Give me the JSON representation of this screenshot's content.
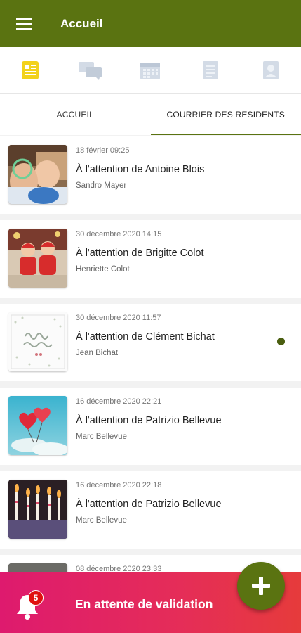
{
  "appbar": {
    "title": "Accueil",
    "menu_icon": "menu-icon",
    "color": "#5a7311"
  },
  "iconbar": {
    "items": [
      {
        "icon": "newspaper-icon",
        "active": true
      },
      {
        "icon": "chat-bubbles-icon",
        "active": false
      },
      {
        "icon": "calendar-icon",
        "active": false
      },
      {
        "icon": "document-icon",
        "active": false
      },
      {
        "icon": "contact-card-icon",
        "active": false
      }
    ]
  },
  "tabs": [
    {
      "label": "ACCUEIL",
      "active": false
    },
    {
      "label": "COURRIER DES RESIDENTS",
      "active": true
    }
  ],
  "messages": [
    {
      "date": "18 février 09:25",
      "title": "À l'attention de Antoine Blois",
      "author": "Sandro Mayer",
      "unread": false
    },
    {
      "date": "30 décembre 2020 14:15",
      "title": "À l'attention de Brigitte Colot",
      "author": "Henriette Colot",
      "unread": false
    },
    {
      "date": "30 décembre 2020 11:57",
      "title": "À l'attention de Clément Bichat",
      "author": "Jean Bichat",
      "unread": true
    },
    {
      "date": "16 décembre 2020 22:21",
      "title": "À l'attention de Patrizio Bellevue",
      "author": "Marc Bellevue",
      "unread": false
    },
    {
      "date": "16 décembre 2020 22:18",
      "title": "À l'attention de Patrizio Bellevue",
      "author": "Marc Bellevue",
      "unread": false
    },
    {
      "date": "08 décembre 2020 23:33",
      "title": "",
      "author": "",
      "unread": false
    }
  ],
  "bottombar": {
    "badge_count": "5",
    "label": "En attente de validation"
  },
  "fab": {
    "icon": "plus-icon"
  }
}
